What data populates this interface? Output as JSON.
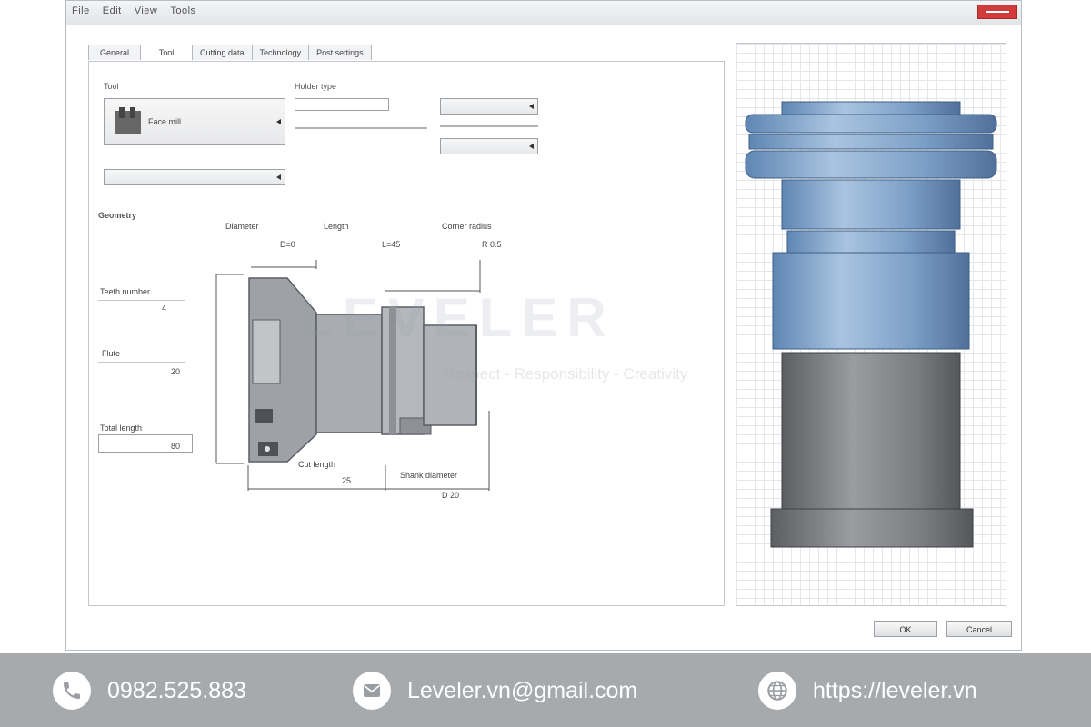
{
  "window": {
    "menu": [
      "File",
      "Edit",
      "View",
      "Tools"
    ],
    "tabs": [
      "General",
      "Tool",
      "Cutting data",
      "Technology",
      "Post settings"
    ],
    "labels": {
      "tool_type": "Tool",
      "holder": "Holder type",
      "section": "Geometry",
      "dim_a": "Diameter",
      "dim_b": "Length",
      "dim_c": "Corner radius",
      "val_a": "D=0",
      "val_b": "L=45",
      "val_c": "R 0.5",
      "left_1": "Teeth number",
      "left_1_val": "4",
      "left_2": "Flute",
      "left_2_val": "20",
      "left_3": "Total length",
      "left_3_val": "80",
      "bottom_1": "Cut length",
      "bottom_1_val": "25",
      "bottom_2": "Shank diameter",
      "bottom_2_val": "D 20"
    },
    "fields": {
      "tool_select": "Face mill",
      "holder_select": "",
      "opt_1": "",
      "opt_2": ""
    },
    "buttons": {
      "ok": "OK",
      "cancel": "Cancel"
    }
  },
  "watermark": {
    "brand": "LEVELER",
    "tagline": "Respect - Responsibility - Creativity"
  },
  "footer": {
    "phone": "0982.525.883",
    "email": "Leveler.vn@gmail.com",
    "website": "https://leveler.vn"
  }
}
